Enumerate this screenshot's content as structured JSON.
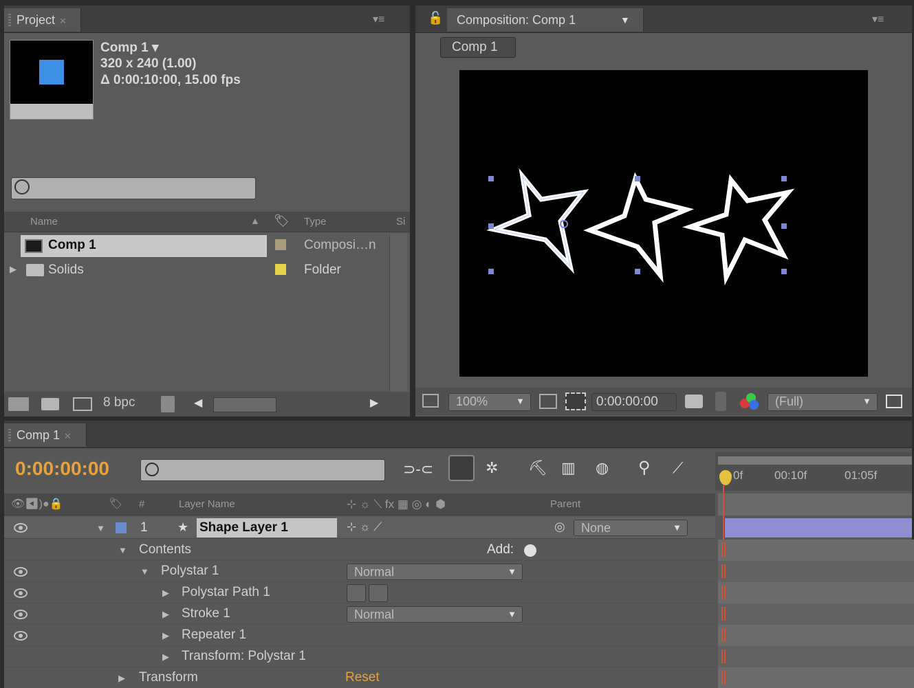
{
  "project": {
    "tab_label": "Project",
    "comp_name": "Comp 1 ▾",
    "comp_size": "320 x 240 (1.00)",
    "comp_duration": "Δ 0:00:10:00, 15.00 fps",
    "search_placeholder": "",
    "columns": {
      "name": "Name",
      "type": "Type",
      "size": "Si"
    },
    "items": [
      {
        "name": "Comp 1",
        "type": "Composi…n",
        "label_color": "#a89c7c",
        "icon": "composition-icon"
      },
      {
        "name": "Solids",
        "type": "Folder",
        "label_color": "#e8d44a",
        "icon": "folder-icon"
      }
    ],
    "bit_depth": "8 bpc"
  },
  "composition": {
    "tab_label": "Composition: Comp 1",
    "breadcrumb": "Comp 1",
    "zoom": "100%",
    "timecode": "0:00:00:00",
    "resolution": "(Full)"
  },
  "timeline": {
    "tab_label": "Comp 1",
    "current_time": "0:00:00:00",
    "search_placeholder": "",
    "ruler_labels": [
      "0f",
      "00:10f",
      "01:05f"
    ],
    "columns": {
      "layer_num": "#",
      "layer_name": "Layer Name",
      "parent": "Parent"
    },
    "layer": {
      "number": "1",
      "name": "Shape Layer 1",
      "parent": "None",
      "label_color": "#6b8bd6"
    },
    "contents_label": "Contents",
    "add_label": "Add:",
    "polystar_label": "Polystar 1",
    "polystar_blend": "Normal",
    "polystar_path_label": "Polystar Path 1",
    "stroke_label": "Stroke 1",
    "stroke_blend": "Normal",
    "repeater_label": "Repeater 1",
    "transform_polystar_label": "Transform: Polystar 1",
    "transform_label": "Transform",
    "reset_label": "Reset"
  },
  "colors": {
    "accent_timecode": "#e6a23c",
    "layer_bar": "#8e8ed0",
    "keyframe": "#d8503a"
  }
}
